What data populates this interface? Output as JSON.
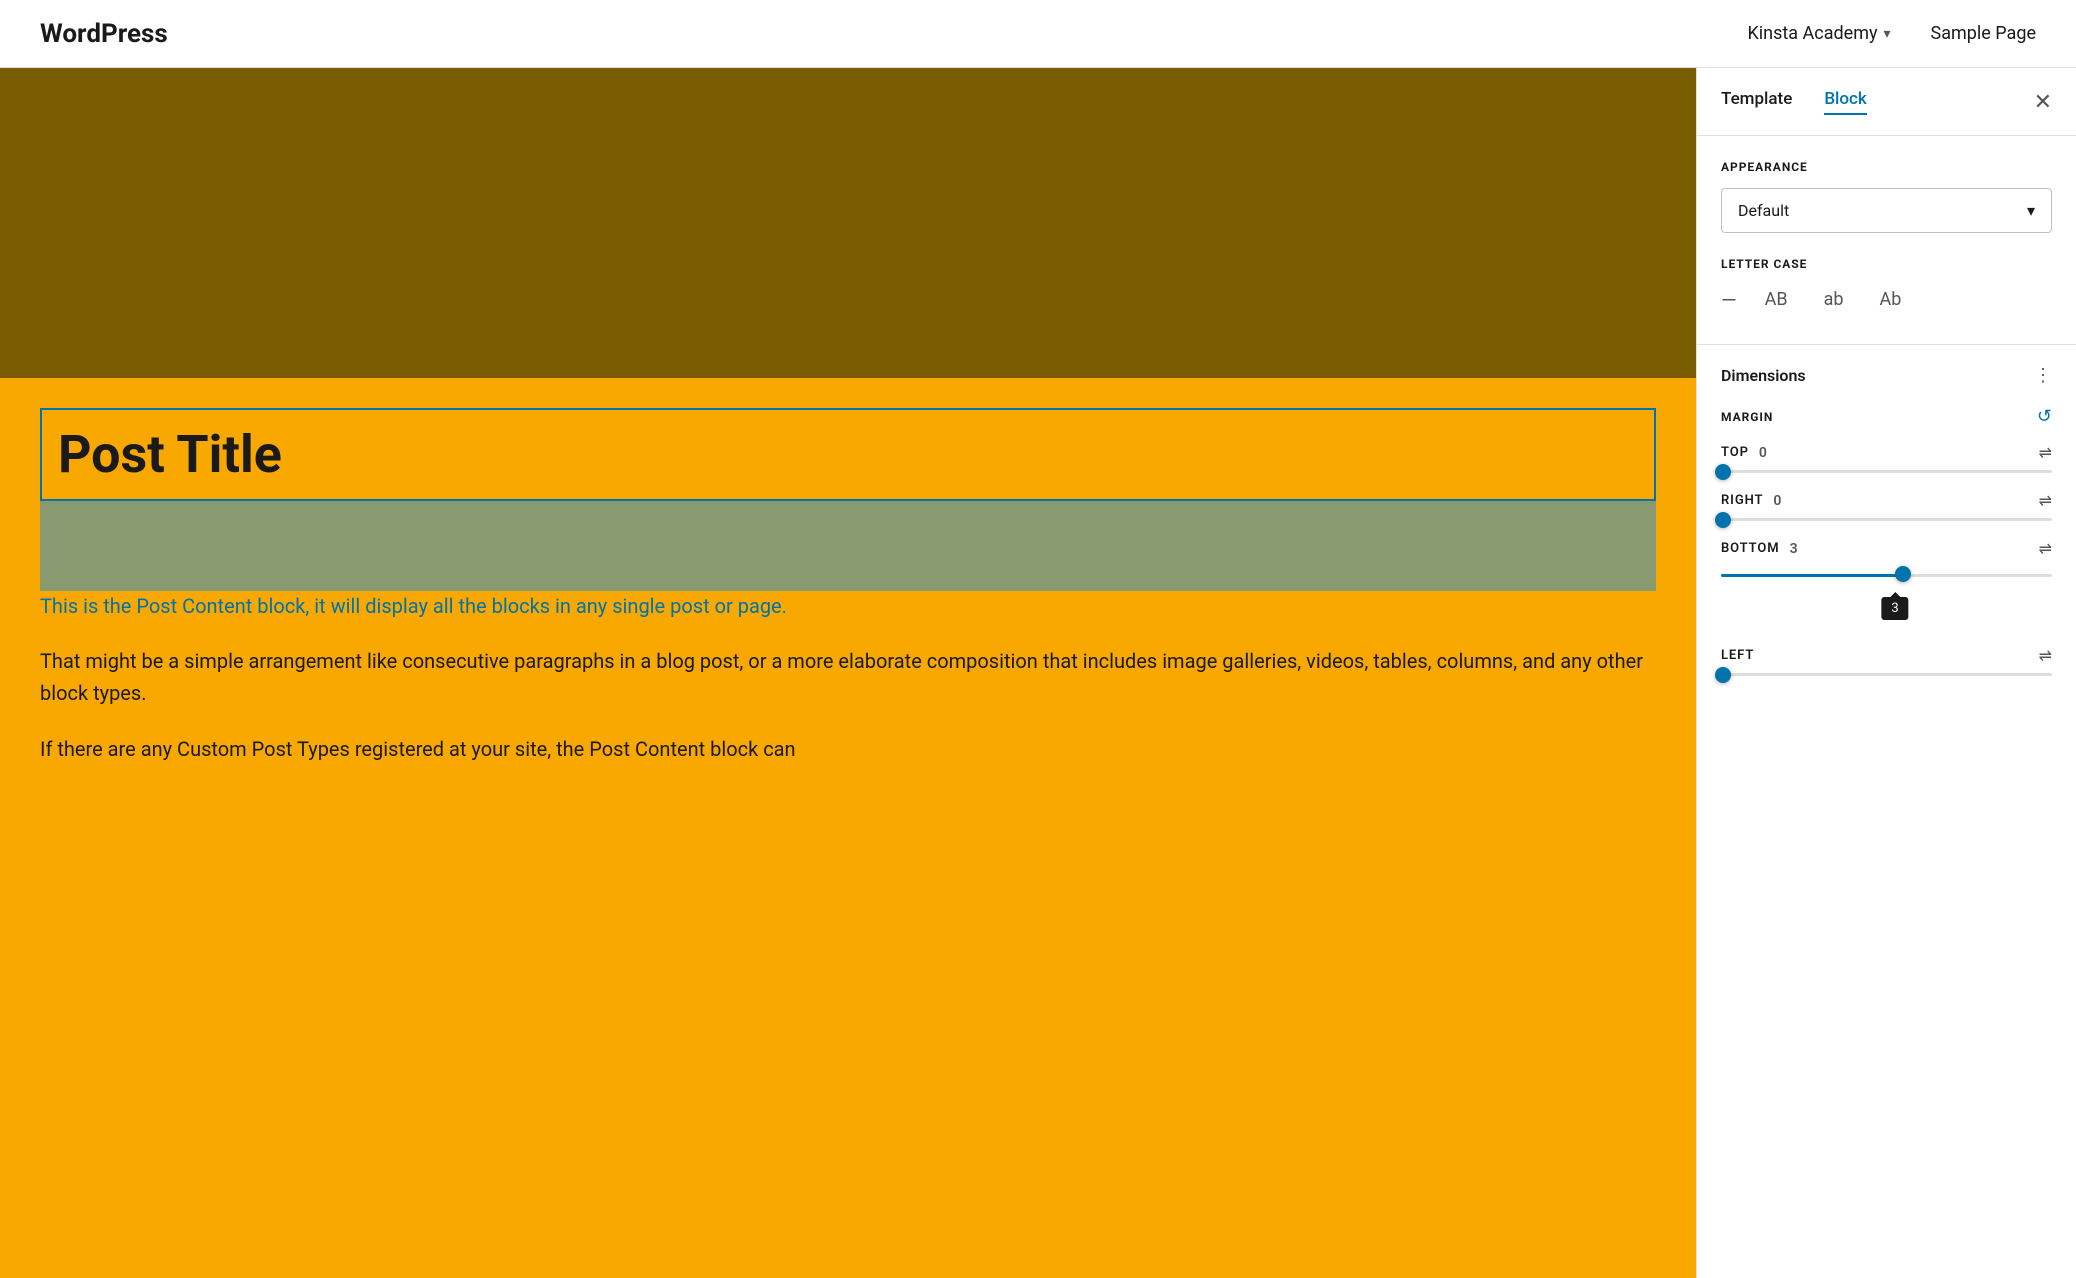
{
  "topbar": {
    "logo": "WordPress",
    "nav": {
      "academy": "Kinsta Academy",
      "academy_chevron": "▾",
      "sample_page": "Sample Page"
    }
  },
  "canvas": {
    "post_title": "Post Title",
    "post_content_desc": "This is the Post Content block, it will display all the blocks in any single post or page.",
    "post_content_para1": "That might be a simple arrangement like consecutive paragraphs in a blog post, or a more elaborate composition that includes image galleries, videos, tables, columns, and any other block types.",
    "post_content_para2": "If there are any Custom Post Types registered at your site, the Post Content block can"
  },
  "panel": {
    "tab_template": "Template",
    "tab_block": "Block",
    "close_label": "✕",
    "appearance_label": "APPEARANCE",
    "appearance_value": "Default",
    "letter_case_label": "LETTER CASE",
    "letter_case_options": [
      "—",
      "AB",
      "ab",
      "Ab"
    ],
    "dimensions_label": "Dimensions",
    "three_dots": "⋮",
    "margin_label": "MARGIN",
    "reset_icon": "↺",
    "fields": [
      {
        "label": "TOP",
        "value": "0",
        "fill_pct": 0,
        "thumb_pct": 0
      },
      {
        "label": "RIGHT",
        "value": "0",
        "fill_pct": 0,
        "thumb_pct": 0
      },
      {
        "label": "BOTTOM",
        "value": "3",
        "fill_pct": 55,
        "thumb_pct": 55,
        "has_tooltip": true,
        "tooltip_value": "3"
      },
      {
        "label": "LEFT",
        "value": "",
        "fill_pct": 0,
        "thumb_pct": 0
      }
    ]
  }
}
